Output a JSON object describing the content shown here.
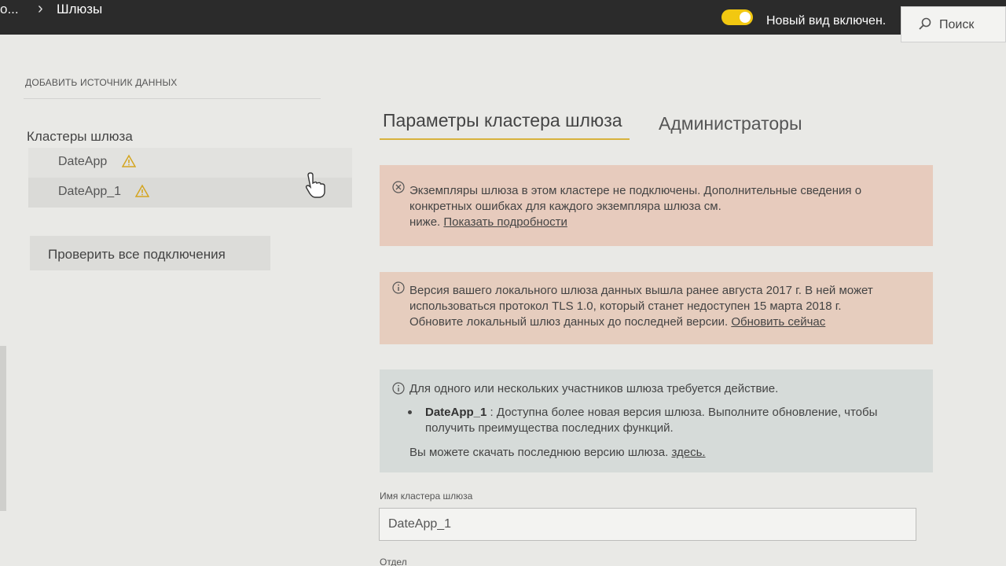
{
  "header": {
    "prev_crumb": "о...",
    "current_crumb": "Шлюзы",
    "toggle_label": "Новый вид включен.",
    "search_label": "Поиск"
  },
  "sidebar": {
    "add_source": "ДОБАВИТЬ ИСТОЧНИК ДАННЫХ",
    "clusters_title": "Кластеры шлюза",
    "clusters": [
      {
        "name": "DateApp",
        "icon": "warning-icon"
      },
      {
        "name": "DateApp_1",
        "icon": "warning-icon"
      }
    ],
    "check_all_label": "Проверить все подключения"
  },
  "tabs": [
    {
      "label": "Параметры кластера шлюза",
      "active": true
    },
    {
      "label": "Администраторы",
      "active": false
    }
  ],
  "alerts": {
    "error1": {
      "line1": "Экземпляры шлюза в этом кластере не подключены. Дополнительные сведения о",
      "line2": "конкретных ошибках для каждого экземпляра шлюза см.",
      "line3_prefix": "ниже.",
      "link": "Показать подробности"
    },
    "error2": {
      "line1": "Версия вашего локального шлюза данных вышла ранее августа 2017 г. В ней может",
      "line2": "использоваться протокол TLS 1.0, который станет недоступен 15 марта 2018 г.",
      "line3_prefix": "Обновите локальный шлюз данных до последней версии.",
      "link": "Обновить сейчас"
    },
    "info": {
      "title": "Для одного или нескольких участников шлюза требуется действие.",
      "bullet_name": "DateApp_1",
      "bullet_line1": " : Доступна более новая версия шлюза. Выполните обновление, чтобы",
      "bullet_line2": "получить преимущества последних функций.",
      "download_prefix": "Вы можете скачать последнюю версию шлюза.",
      "download_link": "здесь."
    }
  },
  "form": {
    "cluster_name_label": "Имя кластера шлюза",
    "cluster_name_value": "DateApp_1",
    "department_label": "Отдел"
  },
  "colors": {
    "accent": "#f2c811",
    "error_bg": "#e7cbbd",
    "info_bg": "#d6dbd9",
    "topbar": "#2b2b2b"
  }
}
